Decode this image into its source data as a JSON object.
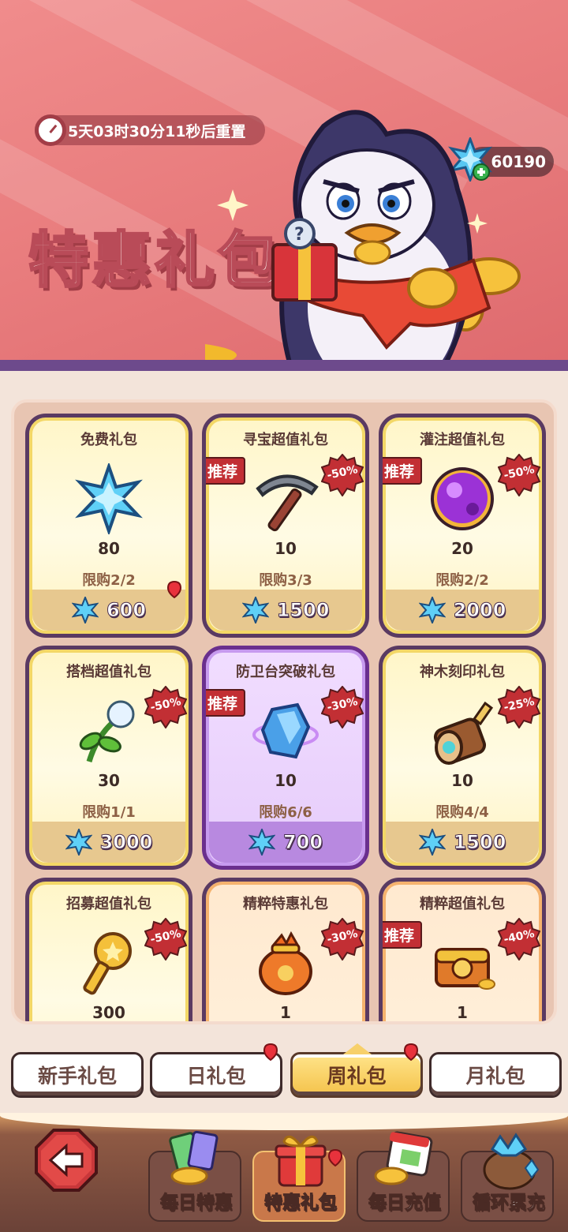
{
  "header": {
    "timer_text": "5天03时30分11秒后重置",
    "currency_amount": "60190",
    "title": "特惠礼包"
  },
  "packs": [
    {
      "title": "免费礼包",
      "icon": "snowflake-gem-icon",
      "quantity": "80",
      "limit": "限购2/2",
      "price": "600",
      "recommended": false,
      "discount": "",
      "theme": "yellow"
    },
    {
      "title": "寻宝超值礼包",
      "icon": "pickaxe-icon",
      "quantity": "10",
      "limit": "限购3/3",
      "price": "1500",
      "recommended": true,
      "discount": "-50%",
      "theme": "yellow"
    },
    {
      "title": "灌注超值礼包",
      "icon": "purple-orb-icon",
      "quantity": "20",
      "limit": "限购2/2",
      "price": "2000",
      "recommended": true,
      "discount": "-50%",
      "theme": "yellow"
    },
    {
      "title": "搭档超值礼包",
      "icon": "flower-sprout-icon",
      "quantity": "30",
      "limit": "限购1/1",
      "price": "3000",
      "recommended": false,
      "discount": "-50%",
      "theme": "yellow"
    },
    {
      "title": "防卫台突破礼包",
      "icon": "blue-crystal-icon",
      "quantity": "10",
      "limit": "限购6/6",
      "price": "700",
      "recommended": true,
      "discount": "-30%",
      "theme": "purple"
    },
    {
      "title": "神木刻印礼包",
      "icon": "wood-log-icon",
      "quantity": "10",
      "limit": "限购4/4",
      "price": "1500",
      "recommended": false,
      "discount": "-25%",
      "theme": "yellow"
    },
    {
      "title": "招募超值礼包",
      "icon": "golden-key-icon",
      "quantity": "300",
      "limit": "",
      "price": "",
      "recommended": false,
      "discount": "-50%",
      "theme": "yellow"
    },
    {
      "title": "精粹特惠礼包",
      "icon": "essence-bag-icon",
      "quantity": "1",
      "limit": "",
      "price": "",
      "recommended": false,
      "discount": "-30%",
      "theme": "orange"
    },
    {
      "title": "精粹超值礼包",
      "icon": "treasure-chest-icon",
      "quantity": "1",
      "limit": "",
      "price": "",
      "recommended": true,
      "discount": "-40%",
      "theme": "orange"
    }
  ],
  "badges": {
    "recommended": "推荐"
  },
  "tabs": [
    {
      "label": "新手礼包",
      "active": false,
      "dot": false
    },
    {
      "label": "日礼包",
      "active": false,
      "dot": true
    },
    {
      "label": "周礼包",
      "active": true,
      "dot": true
    },
    {
      "label": "月礼包",
      "active": false,
      "dot": false
    }
  ],
  "bottom_nav": [
    {
      "label": "每日特惠",
      "icon": "cards-coins-icon",
      "active": false
    },
    {
      "label": "特惠礼包",
      "icon": "gift-box-icon",
      "active": true
    },
    {
      "label": "每日充值",
      "icon": "calendar-coins-icon",
      "active": false
    },
    {
      "label": "循环累充",
      "icon": "gem-sack-icon",
      "active": false
    }
  ],
  "colors": {
    "banner": "#e97d7e",
    "card_yellow": "#fff6c8",
    "card_purple": "#e6ccfb",
    "card_orange": "#ffe9cf",
    "badge_red": "#c22f34",
    "outline": "#5a3a62"
  }
}
